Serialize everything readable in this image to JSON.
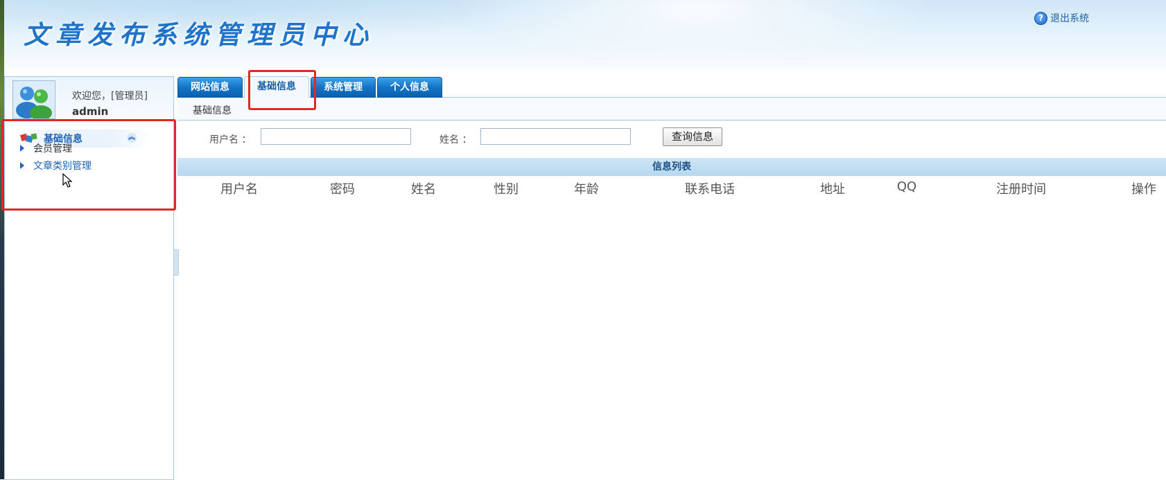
{
  "header": {
    "title": "文章发布系统管理员中心",
    "logout_label": "退出系统"
  },
  "user": {
    "welcome": "欢迎您，[管理员]",
    "username": "admin"
  },
  "sidebar": {
    "group_label": "基础信息",
    "items": [
      {
        "label": "会员管理"
      },
      {
        "label": "文章类别管理"
      }
    ]
  },
  "tabs": [
    {
      "label": "网站信息"
    },
    {
      "label": "基础信息"
    },
    {
      "label": "系统管理"
    },
    {
      "label": "个人信息"
    }
  ],
  "breadcrumb": "基础信息",
  "search": {
    "username_label": "用户名 ：",
    "username_value": "",
    "name_label": "姓名 ：",
    "name_value": "",
    "button_label": "查询信息"
  },
  "table": {
    "title": "信息列表",
    "columns": [
      "用户名",
      "密码",
      "姓名",
      "性别",
      "年龄",
      "联系电话",
      "地址",
      "QQ",
      "注册时间",
      "操作"
    ],
    "rows": []
  },
  "colors": {
    "tab_blue": "#1274c6",
    "title_blue": "#1f74c9",
    "annotation_red": "#e32626"
  }
}
